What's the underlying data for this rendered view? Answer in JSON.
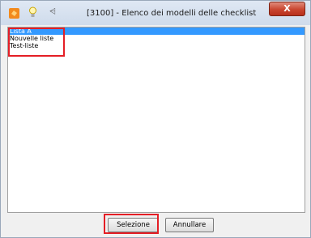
{
  "window": {
    "title": "[3100] - Elenco dei modelli delle checklist",
    "close_label": "X"
  },
  "icons": {
    "app": "app-icon",
    "bulb": "lightbulb-icon",
    "quick_access": "quick-access-dropdown-icon"
  },
  "list": {
    "items": [
      {
        "label": "Lista A",
        "selected": true
      },
      {
        "label": "Nouvelle liste",
        "selected": false
      },
      {
        "label": "Test-liste",
        "selected": false
      }
    ]
  },
  "buttons": {
    "select_label": "Selezione",
    "cancel_label": "Annullare"
  },
  "colors": {
    "selection": "#3399ff",
    "highlight": "#e41e25",
    "close": "#c9452f"
  }
}
